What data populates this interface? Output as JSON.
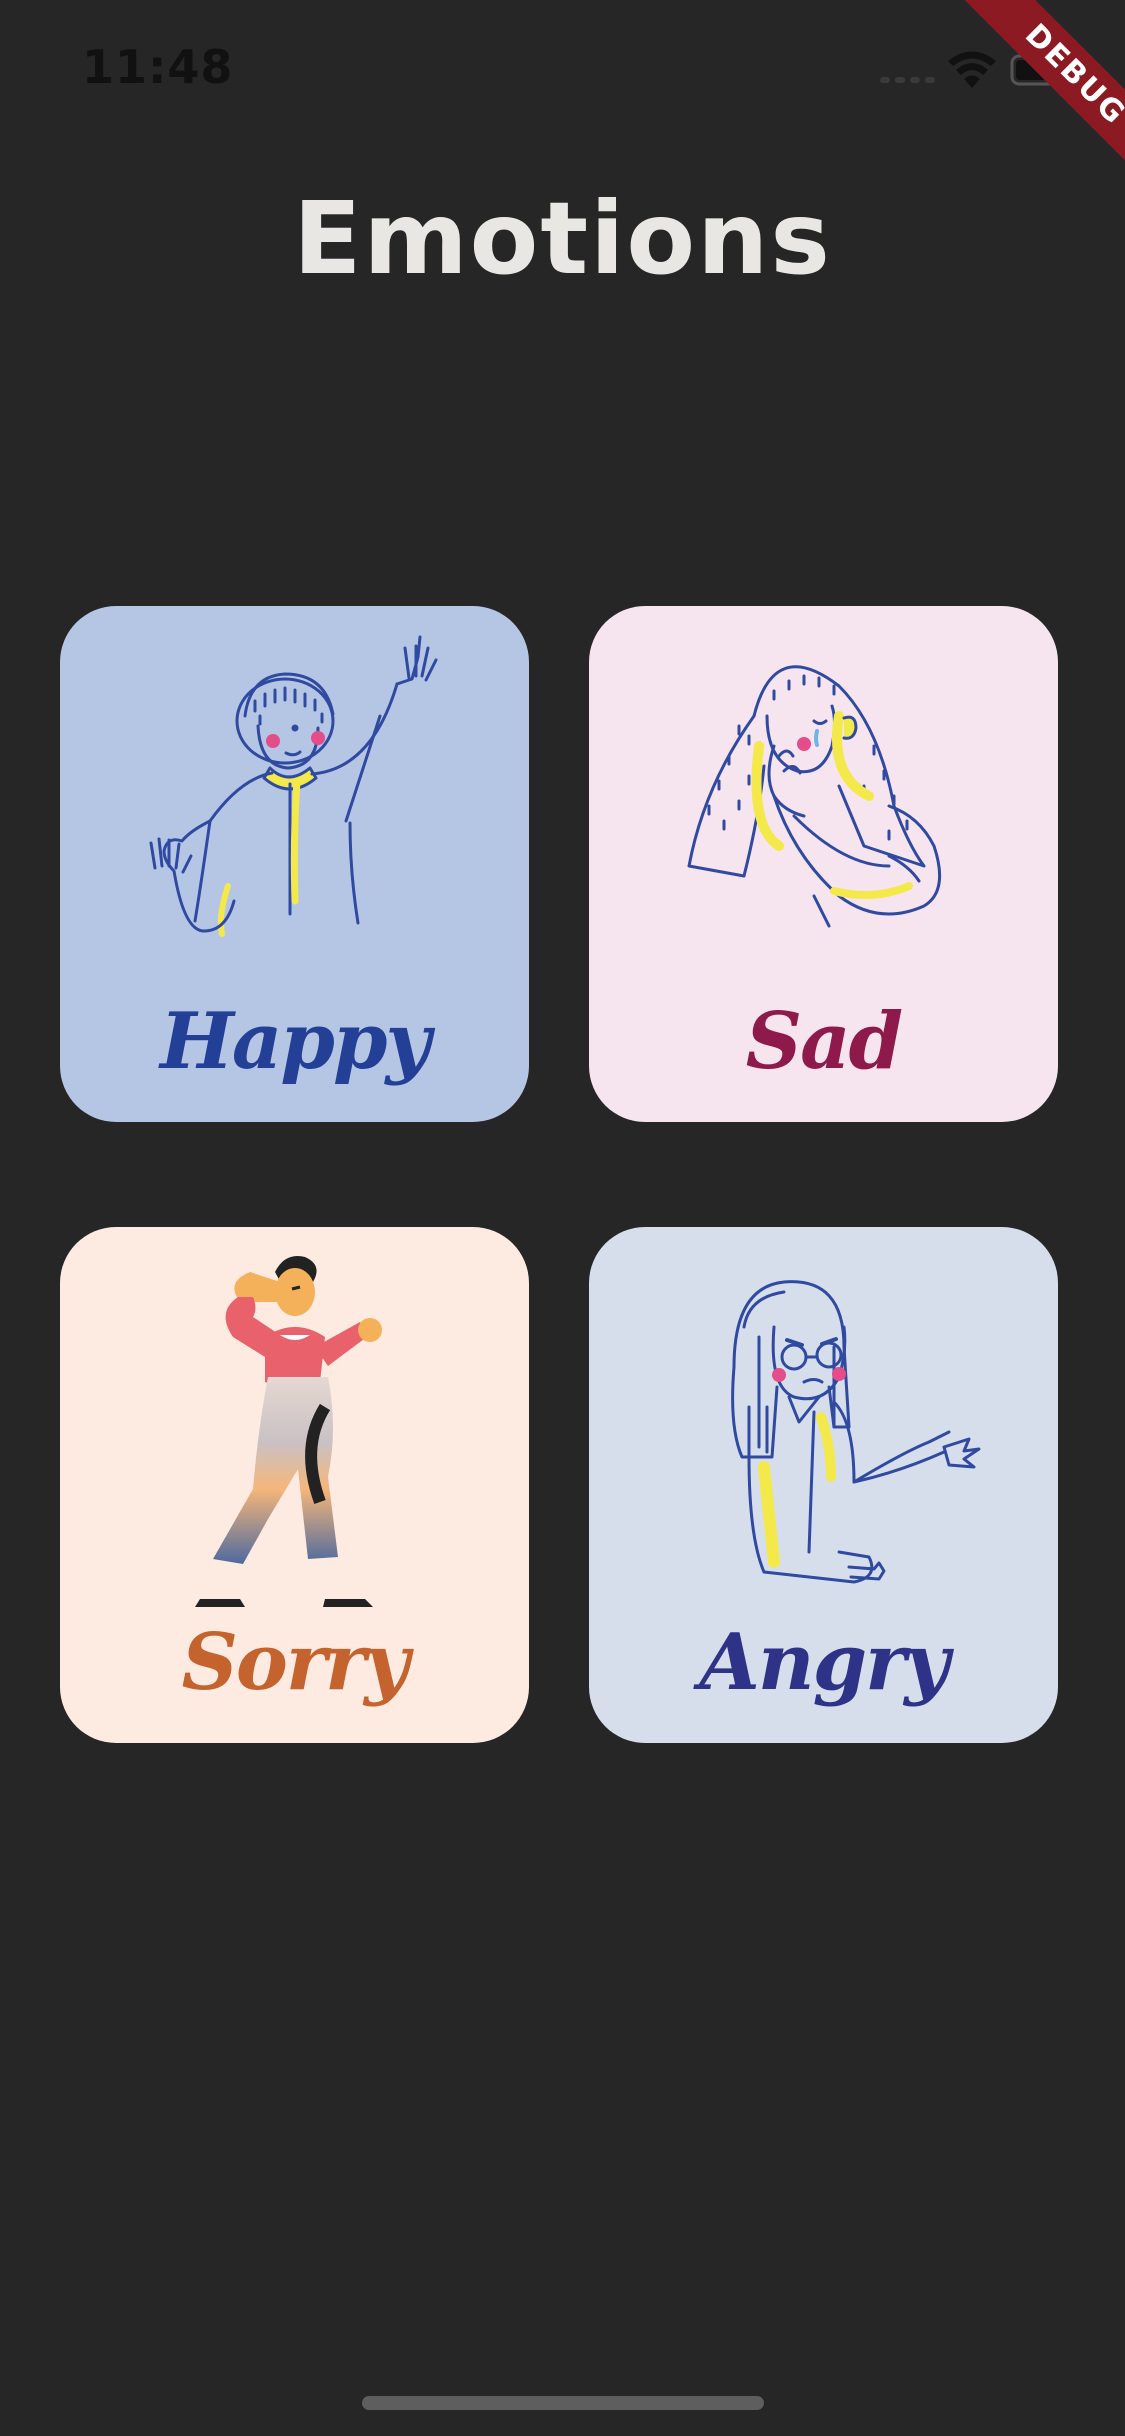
{
  "status_bar": {
    "time": "11:48",
    "icons": [
      "signal-icon",
      "wifi-icon",
      "battery-icon"
    ]
  },
  "debug_banner": "DEBUG",
  "title": "Emotions",
  "cards": [
    {
      "label": "Happy",
      "bg": "#b5c6e5",
      "label_color": "#233f96",
      "icon": "happy-person-illustration"
    },
    {
      "label": "Sad",
      "bg": "#f6e4ee",
      "label_color": "#8e1a4c",
      "icon": "sad-person-illustration"
    },
    {
      "label": "Sorry",
      "bg": "#fdebe1",
      "label_color": "#c5632e",
      "icon": "sorry-person-illustration"
    },
    {
      "label": "Angry",
      "bg": "#d6deec",
      "label_color": "#2e3388",
      "icon": "angry-person-illustration"
    }
  ],
  "colors": {
    "background": "#262626",
    "title": "#e9e7e4",
    "debug_ribbon": "#8b1a22"
  }
}
